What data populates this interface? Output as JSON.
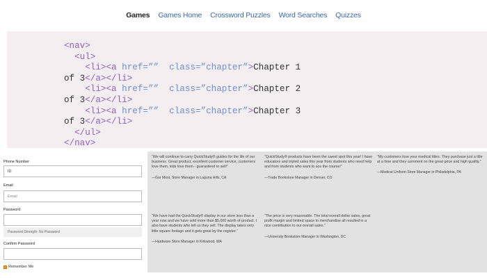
{
  "nav": {
    "items": [
      "Games",
      "Games Home",
      "Crossword Puzzles",
      "Word Searches",
      "Quizzes"
    ],
    "active": 0
  },
  "code": {
    "lines": [
      {
        "indent": "",
        "parts": [
          [
            "tag",
            "<nav>"
          ]
        ]
      },
      {
        "indent": "  ",
        "parts": [
          [
            "tag",
            "<ul>"
          ]
        ]
      },
      {
        "indent": "    ",
        "parts": [
          [
            "tag",
            "<li><a "
          ],
          [
            "attr",
            "href="
          ],
          [
            "str",
            "”” "
          ],
          [
            "attr",
            " class="
          ],
          [
            "str",
            "”chapter”"
          ],
          [
            "tag",
            ">"
          ],
          [
            "txt",
            "Chapter 1"
          ]
        ]
      },
      {
        "indent": "",
        "parts": [
          [
            "txt",
            "of 3"
          ],
          [
            "tag",
            "</a></li>"
          ]
        ]
      },
      {
        "indent": "    ",
        "parts": [
          [
            "tag",
            "<li><a "
          ],
          [
            "attr",
            "href="
          ],
          [
            "str",
            "”” "
          ],
          [
            "attr",
            " class="
          ],
          [
            "str",
            "”chapter”"
          ],
          [
            "tag",
            ">"
          ],
          [
            "txt",
            "Chapter 2"
          ]
        ]
      },
      {
        "indent": "",
        "parts": [
          [
            "txt",
            "of 3"
          ],
          [
            "tag",
            "</a></li>"
          ]
        ]
      },
      {
        "indent": "    ",
        "parts": [
          [
            "tag",
            "<li><a "
          ],
          [
            "attr",
            "href="
          ],
          [
            "str",
            "”” "
          ],
          [
            "attr",
            " class="
          ],
          [
            "str",
            "”chapter”"
          ],
          [
            "tag",
            ">"
          ],
          [
            "txt",
            "Chapter 3"
          ]
        ]
      },
      {
        "indent": "",
        "parts": [
          [
            "txt",
            "of 3"
          ],
          [
            "tag",
            "</a></li>"
          ]
        ]
      },
      {
        "indent": "  ",
        "parts": [
          [
            "tag",
            "</ul>"
          ]
        ]
      },
      {
        "indent": "",
        "parts": [
          [
            "tag",
            "</nav>"
          ]
        ]
      }
    ]
  },
  "form": {
    "phone_label": "Phone Number",
    "phone_value": "ID",
    "email_label": "Email",
    "email_placeholder": "Email",
    "password_label": "Password",
    "password_hint": "Password Strength: No Password",
    "confirm_label": "Confirm Password",
    "remember_label": "Remember Me"
  },
  "testimonials": [
    {
      "quote": "“We will continue to carry QuickStudy® guides for the life of our business. Great product, excellent customer service, customers love them, kids love them - guaranteed to sell!”",
      "by": "—Gar Most, Store Manager in Laguna Hills, CA"
    },
    {
      "quote": "“QuickStudy® products have been the sweet spot this year! I have educators and tripled sales this year from students who need help and from students who want to ace the course!”",
      "by": "—Trade Bookstore Manager in Denver, CO"
    },
    {
      "quote": "“My customers love your medical titles. They purchase just a title at a time and they comment on the great price and high quality.”",
      "by": "—Medical Uniform Store Manager in Philadelphia, PA"
    },
    {
      "quote": "“We have had the QuickStudy® display in our store less than a year now and we have sold more than $5,000 worth of product. I also have students who tell us they sell. The display takes very little square footage and it gets great by the register.”",
      "by": "—Hardware Store Manager in Kirkwood, WA"
    },
    {
      "quote": "“The price is very reasonable. The total overall dollar sales, great profit margin and limited space to merchandise all resulted in a nice contribution to our overall sales.”",
      "by": "—University Bookstore Manager in Washington, DC"
    }
  ]
}
